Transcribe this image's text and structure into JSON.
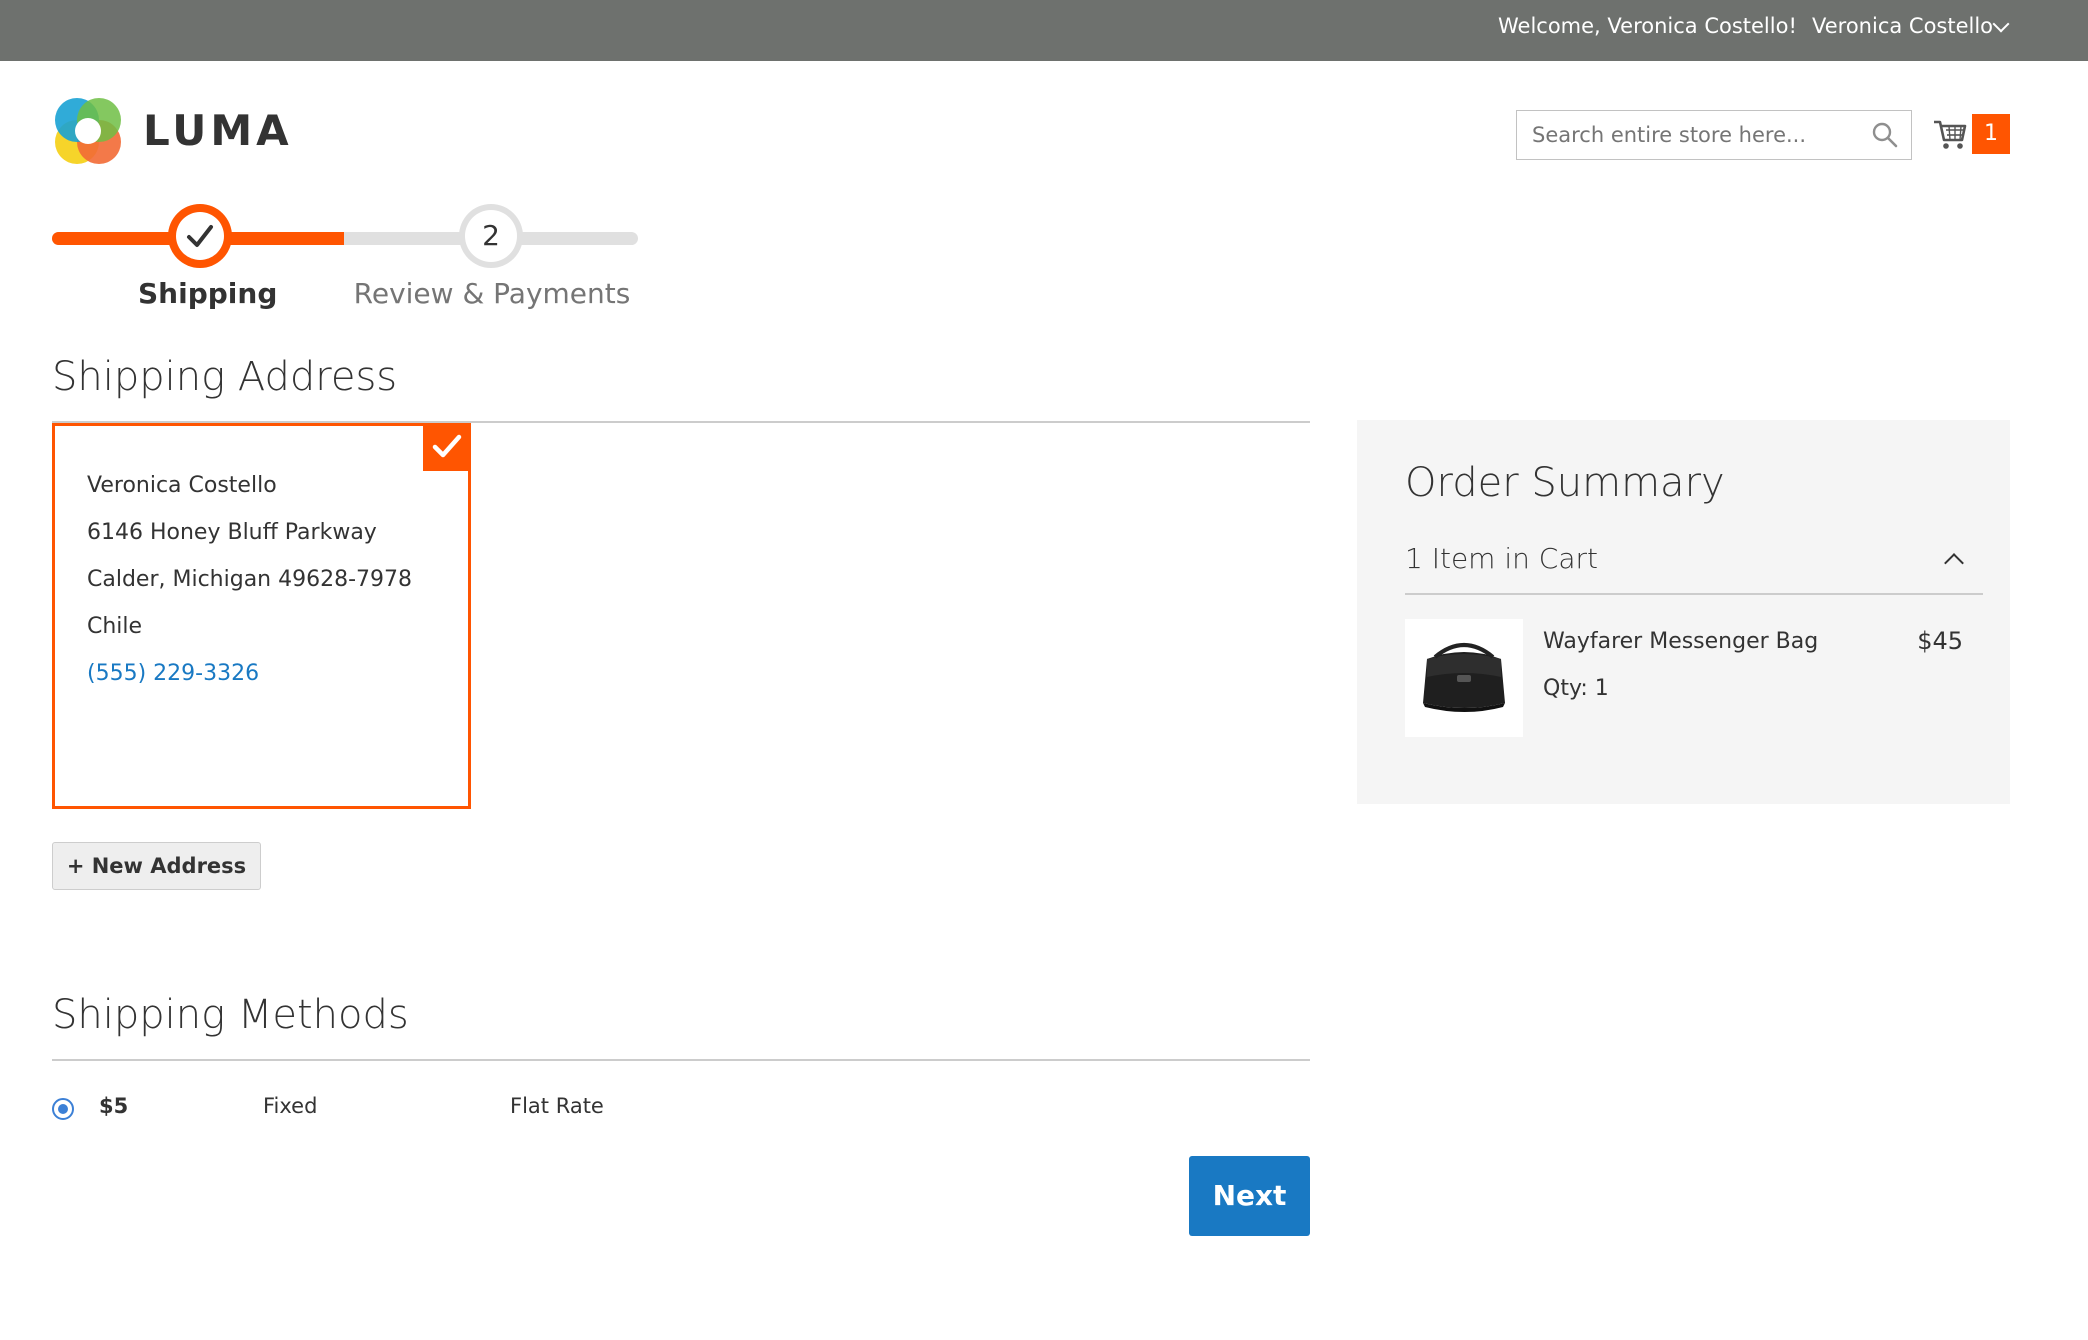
{
  "topbar": {
    "welcome": "Welcome, Veronica Costello!",
    "account_name": "Veronica Costello"
  },
  "header": {
    "logo_text": "LUMA",
    "search_placeholder": "Search entire store here...",
    "cart_count": "1"
  },
  "progress": {
    "steps": [
      {
        "label": "Shipping",
        "state": "complete"
      },
      {
        "label": "Review & Payments",
        "number": "2",
        "state": "pending"
      }
    ]
  },
  "shipping_address": {
    "title": "Shipping Address",
    "selected": {
      "name": "Veronica Costello",
      "street": "6146 Honey Bluff Parkway",
      "city_line": "Calder, Michigan 49628-7978",
      "country": "Chile",
      "phone": "(555) 229-3326"
    },
    "new_address_label": "+ New Address"
  },
  "shipping_methods": {
    "title": "Shipping Methods",
    "options": [
      {
        "price": "$5",
        "method": "Fixed",
        "carrier": "Flat Rate",
        "selected": true
      }
    ],
    "next_label": "Next"
  },
  "order_summary": {
    "title": "Order Summary",
    "items_count_label": "1 Item in Cart",
    "items": [
      {
        "name": "Wayfarer Messenger Bag",
        "qty_label": "Qty: 1",
        "price": "$45"
      }
    ]
  },
  "colors": {
    "accent": "#ff5501",
    "primary_button": "#1979c3",
    "topbar": "#6e716e",
    "link": "#1979c3"
  }
}
